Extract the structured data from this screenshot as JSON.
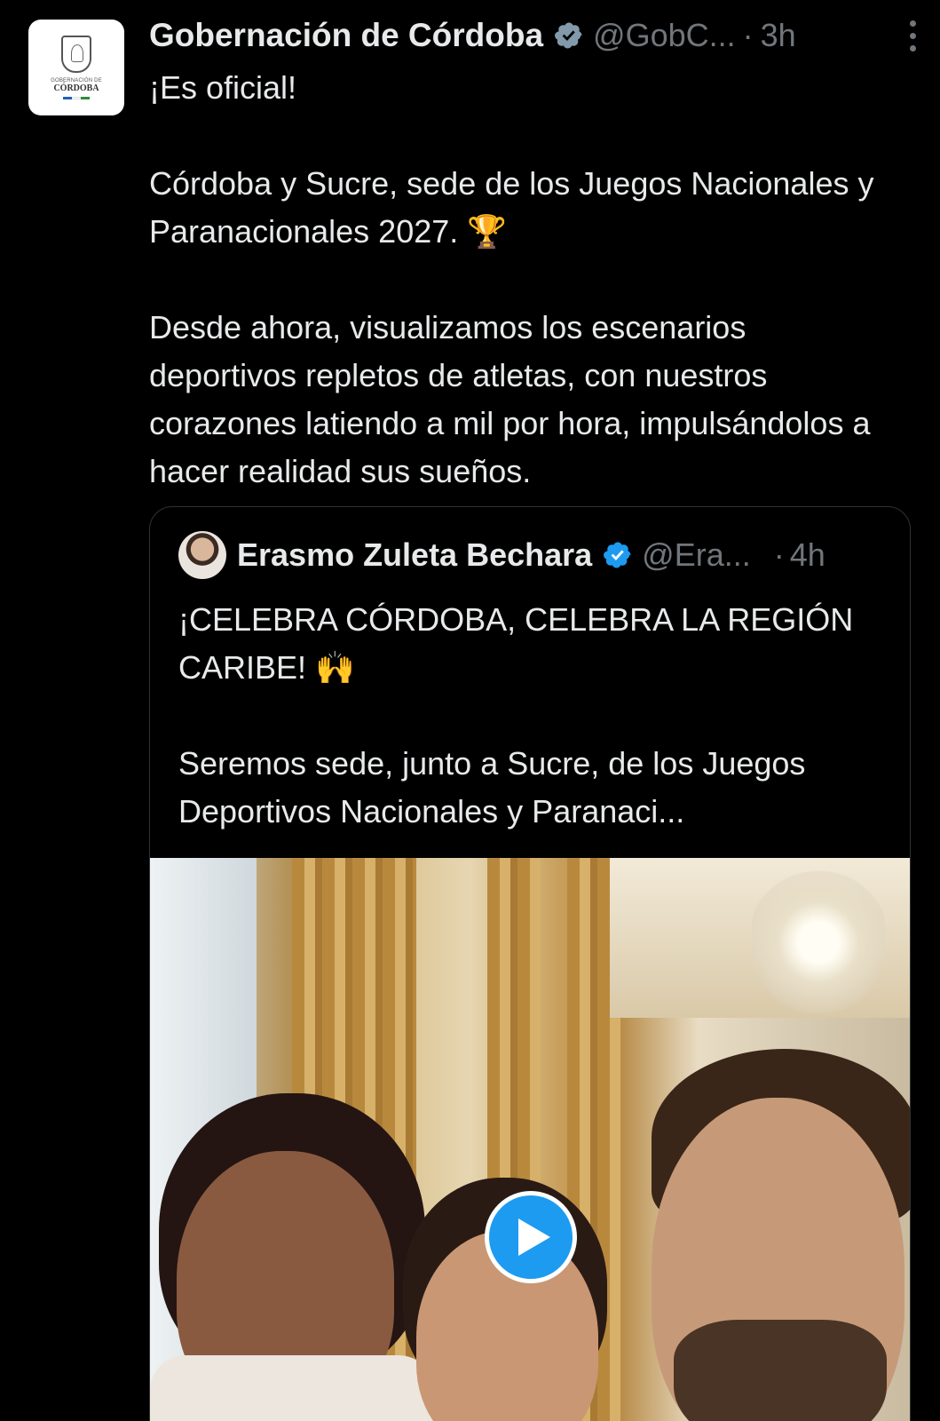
{
  "tweet": {
    "author_name": "Gobernación de Córdoba",
    "handle": "@GobC...",
    "separator": "·",
    "time": "3h",
    "avatar_text": {
      "small": "GOBERNACIÓN DE",
      "big": "CÓRDOBA"
    },
    "body": "¡Es oficial!\n\nCórdoba y Sucre, sede de los Juegos Nacionales y Paranacionales 2027. 🏆\n\nDesde ahora, visualizamos los escenarios deportivos repletos de atletas, con nuestros corazones latiendo a mil por hora, impulsándolos a hacer realidad sus sueños."
  },
  "quote": {
    "author_name": "Erasmo Zuleta Bechara",
    "handle": "@Era...",
    "separator": "·",
    "time": "4h",
    "body": "¡CELEBRA CÓRDOBA, CELEBRA LA REGIÓN CARIBE! 🙌\n\nSeremos sede, junto a Sucre, de los Juegos Deportivos Nacionales y Paranaci..."
  },
  "icons": {
    "verified": "verified-badge-icon",
    "more": "more-options-icon",
    "play": "play-icon"
  },
  "colors": {
    "background": "#000000",
    "text": "#e7e9ea",
    "muted": "#71767b",
    "accent": "#1d9bf0",
    "border": "#2f3336"
  }
}
